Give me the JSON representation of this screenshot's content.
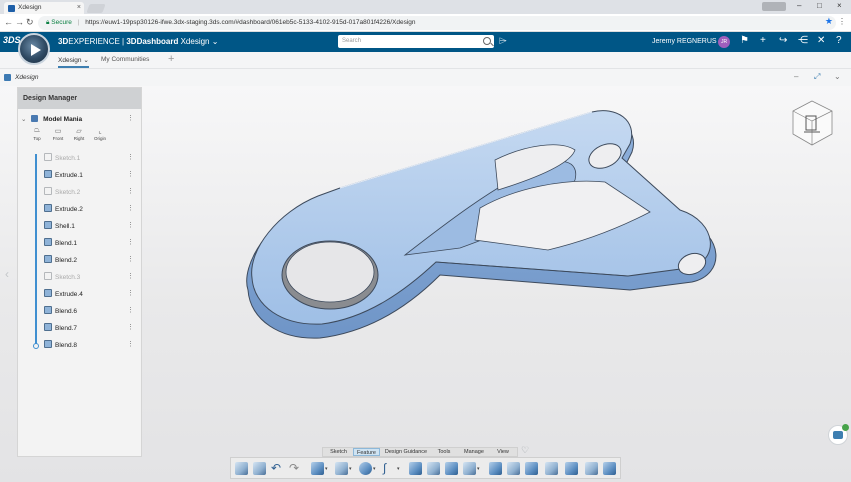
{
  "browser": {
    "tab_title": "Xdesign",
    "tab_close": "×",
    "user_chip": "",
    "secure_label": "Secure",
    "url": "https://euw1-19psp30126-ifwe.3dx-staging.3ds.com/#dashboard/061eb5c-5133-4102-915d-017a801f4226/Xdesign",
    "win_min": "–",
    "win_max": "□",
    "win_close": "×"
  },
  "appbar": {
    "brand_prefix": "3D",
    "brand_bold": "EXPERIENCE",
    "separator": " | ",
    "dashboard": "3DDashboard",
    "app_name": "Xdesign",
    "chevron": "⌄",
    "search_placeholder": "Search",
    "user_name": "Jeremy REGNERUS",
    "avatar_initials": "JR"
  },
  "dashboard_tabs": {
    "active": "Xdesign",
    "active_chevron": "⌄",
    "other": "My Communities",
    "add": "+"
  },
  "widget": {
    "title": "Xdesign",
    "minimize": "–",
    "expand": "⤢",
    "menu": "⌄"
  },
  "design_manager": {
    "title": "Design Manager",
    "root": "Model Mania",
    "planes": [
      "Top",
      "Front",
      "Right",
      "Origin"
    ],
    "items": [
      {
        "label": "Sketch.1",
        "kind": "sketch"
      },
      {
        "label": "Extrude.1",
        "kind": "solid"
      },
      {
        "label": "Sketch.2",
        "kind": "sketch"
      },
      {
        "label": "Extrude.2",
        "kind": "solid"
      },
      {
        "label": "Shell.1",
        "kind": "solid"
      },
      {
        "label": "Blend.1",
        "kind": "solid"
      },
      {
        "label": "Blend.2",
        "kind": "solid"
      },
      {
        "label": "Sketch.3",
        "kind": "sketch"
      },
      {
        "label": "Extrude.4",
        "kind": "solid"
      },
      {
        "label": "Blend.6",
        "kind": "solid"
      },
      {
        "label": "Blend.7",
        "kind": "solid"
      },
      {
        "label": "Blend.8",
        "kind": "solid"
      }
    ]
  },
  "action_bar": {
    "tabs": [
      "Sketch",
      "Feature",
      "Design Guidance",
      "Tools",
      "Manage",
      "View"
    ],
    "active_tab": "Feature"
  },
  "colors": {
    "appbar": "#005686",
    "accent": "#3f8fd0",
    "part_face": "#a9c5e9",
    "part_dark": "#6f95c7"
  }
}
